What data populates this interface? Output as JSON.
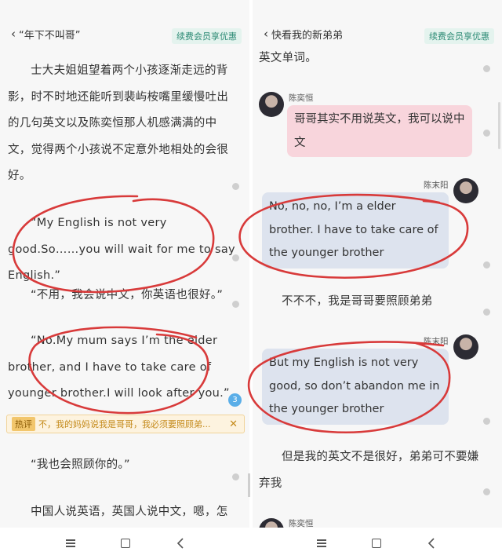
{
  "left": {
    "back_label": "“年下不叫哥”",
    "vip_label": "续费会员享优惠",
    "paragraphs": [
      "士大夫姐姐望着两个小孩逐渐走远的背影，时不时地还能听到裴屿桉嘴里缓慢吐出的几句英文以及陈奕恒那人机感满满的中文，觉得两个小孩说不定意外地相处的会很好。",
      "“My English is not very good.So……you will wait for me to say English.”",
      "“不用，我会说中文，你英语也很好。”",
      "“No.My mum says I’m the elder brother, and I have to take care of younger brother.I will look after you.”",
      "“我也会照顾你的。”",
      "中国人说英语，英国人说中文，嗯，怎么"
    ],
    "hot_comment": {
      "tag": "热评",
      "text": "不，我的妈妈说我是哥哥，我必须要照顾弟...",
      "count": "3"
    }
  },
  "right": {
    "back_label": "快看我的新弟弟",
    "vip_label": "续费会员享优惠",
    "top_text": "英文单词。",
    "messages": [
      {
        "speaker": "陈奕恒",
        "text": "哥哥其实不用说英文，我可以说中文"
      },
      {
        "speaker": "陈末阳",
        "text": "No, no, no, I’m a elder brother. I have to take care of the younger brother"
      },
      {
        "speaker": "陈末阳",
        "text": "But my English is not very good, so don’t abandon me in the younger brother"
      },
      {
        "speaker": "陈奕恒",
        "text": ""
      }
    ],
    "narration_1": "不不不，我是哥哥要照顾弟弟",
    "narration_2": "但是我的英文不是很好，弟弟可不要嫌弃我"
  },
  "colors": {
    "accent": "#2b8a74",
    "pink_bubble": "#f8d5dc",
    "blue_bubble": "#dde3ee",
    "annotation_red": "#d83a3a"
  },
  "icons": [
    "menu-icon",
    "home-icon",
    "back-icon",
    "chevron-left-icon",
    "close-icon"
  ]
}
